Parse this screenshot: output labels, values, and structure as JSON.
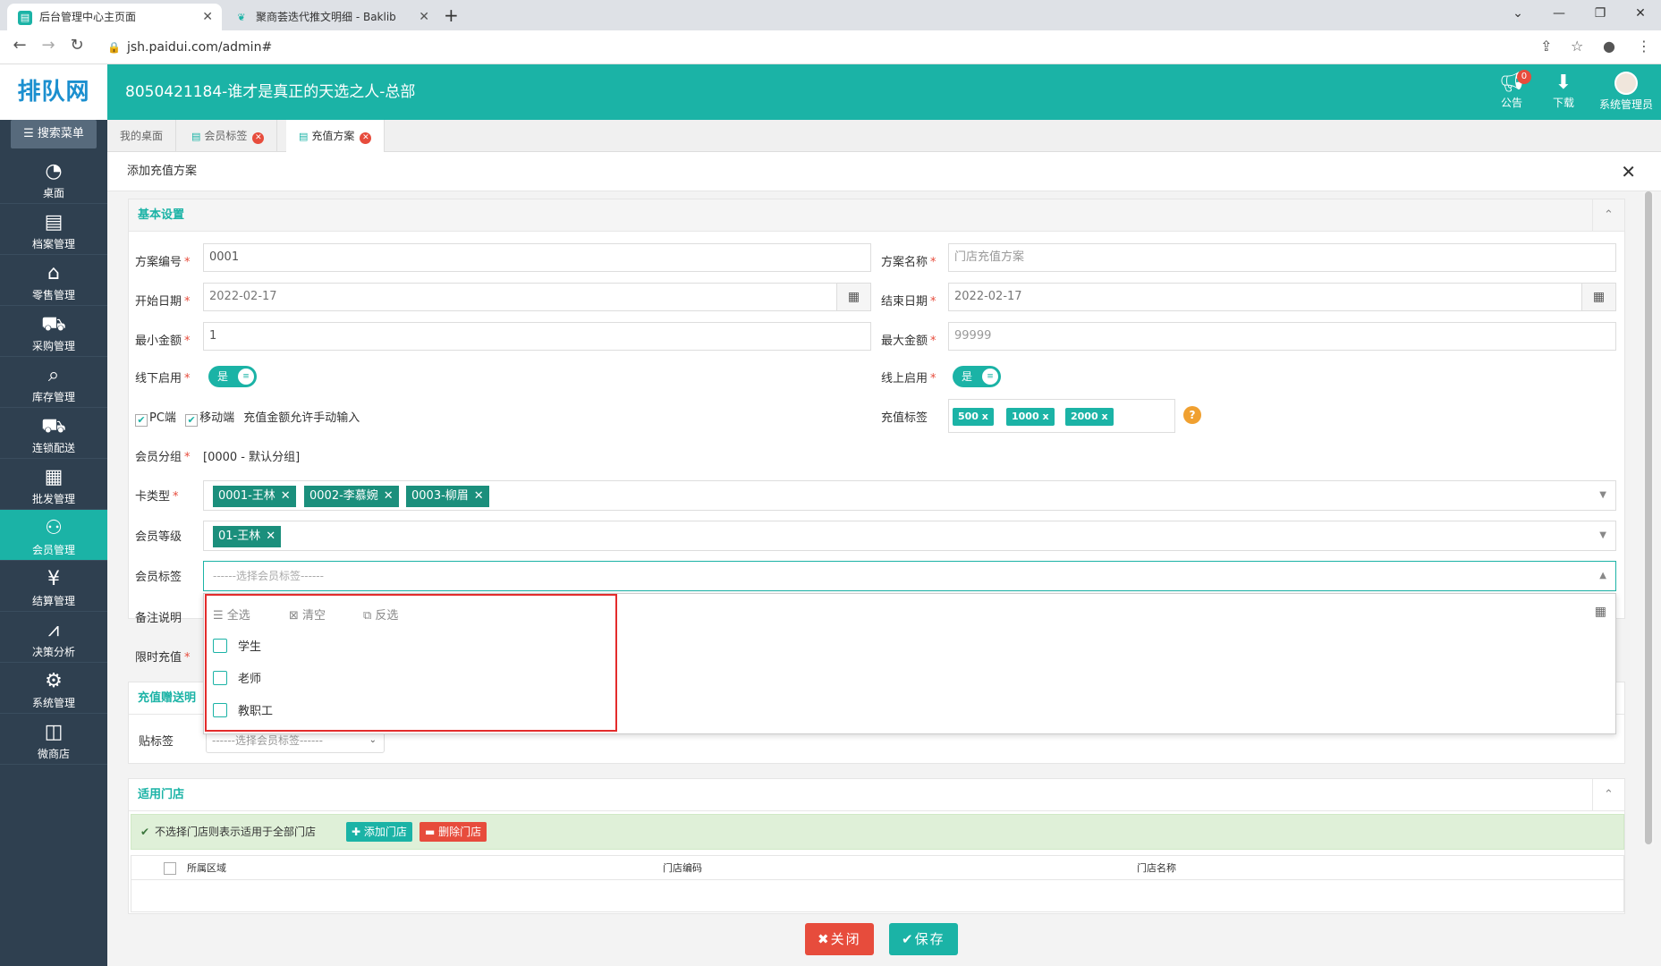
{
  "browser": {
    "tabs": [
      {
        "title": "后台管理中心主页面",
        "active": true
      },
      {
        "title": "聚商荟迭代推文明细 - Baklib",
        "active": false
      }
    ],
    "url": "jsh.paidui.com/admin#"
  },
  "header": {
    "logo": "排队网",
    "store_title": "8050421184-谁才是真正的天选之人-总部",
    "announce_label": "公告",
    "announce_count": "0",
    "download_label": "下载",
    "user_label": "系统管理员"
  },
  "sidebar": {
    "search_label": "搜索菜单",
    "items": [
      {
        "label": "桌面",
        "icon": "dashboard-icon"
      },
      {
        "label": "档案管理",
        "icon": "archive-icon"
      },
      {
        "label": "零售管理",
        "icon": "store-icon"
      },
      {
        "label": "采购管理",
        "icon": "cart-icon"
      },
      {
        "label": "库存管理",
        "icon": "inventory-icon"
      },
      {
        "label": "连锁配送",
        "icon": "truck-icon"
      },
      {
        "label": "批发管理",
        "icon": "wholesale-icon"
      },
      {
        "label": "会员管理",
        "icon": "member-icon",
        "active": true
      },
      {
        "label": "结算管理",
        "icon": "settlement-icon"
      },
      {
        "label": "决策分析",
        "icon": "analysis-icon"
      },
      {
        "label": "系统管理",
        "icon": "gear-icon"
      },
      {
        "label": "微商店",
        "icon": "shop-bag-icon"
      }
    ]
  },
  "page_tabs": [
    {
      "label": "我的桌面"
    },
    {
      "label": "会员标签"
    },
    {
      "label": "充值方案",
      "active": true
    }
  ],
  "dialog": {
    "title": "添加充值方案",
    "basic": {
      "section": "基本设置",
      "plan_no_label": "方案编号",
      "plan_no_value": "0001",
      "plan_name_label": "方案名称",
      "plan_name_placeholder": "门店充值方案",
      "start_label": "开始日期",
      "start_value": "2022-02-17",
      "end_label": "结束日期",
      "end_value": "2022-02-17",
      "min_label": "最小金额",
      "min_value": "1",
      "max_label": "最大金额",
      "max_placeholder": "99999",
      "offline_label": "线下启用",
      "offline_value": "是",
      "online_label": "线上启用",
      "online_value": "是",
      "pc_label": "PC端",
      "mobile_label": "移动端",
      "manual_label": "充值金额允许手动输入",
      "recharge_tags_label": "充值标签",
      "recharge_tags": [
        "500",
        "1000",
        "2000"
      ],
      "member_group_label": "会员分组",
      "member_group_value": "[0000 - 默认分组]",
      "card_type_label": "卡类型",
      "card_types": [
        "0001-王林",
        "0002-李慕婉",
        "0003-柳眉"
      ],
      "member_level_label": "会员等级",
      "member_levels": [
        "01-王林"
      ],
      "member_tag_label": "会员标签",
      "member_tag_placeholder": "------选择会员标签------",
      "remark_label": "备注说明",
      "limit_label": "限时充值"
    },
    "dropdown": {
      "select_all": "全选",
      "clear": "清空",
      "invert": "反选",
      "options": [
        "学生",
        "老师",
        "教职工"
      ]
    },
    "gift": {
      "section": "充值赠送明",
      "tag_label": "贴标签",
      "tag_placeholder": "------选择会员标签------"
    },
    "stores": {
      "section": "适用门店",
      "note": "不选择门店则表示适用于全部门店",
      "add_btn": "添加门店",
      "del_btn": "删除门店",
      "columns": [
        "所属区域",
        "门店编码",
        "门店名称"
      ]
    },
    "close_btn": "关闭",
    "save_btn": "保存"
  },
  "colors": {
    "accent": "#1bb3a6",
    "sidebar": "#2f4050",
    "danger": "#e74c3c"
  }
}
